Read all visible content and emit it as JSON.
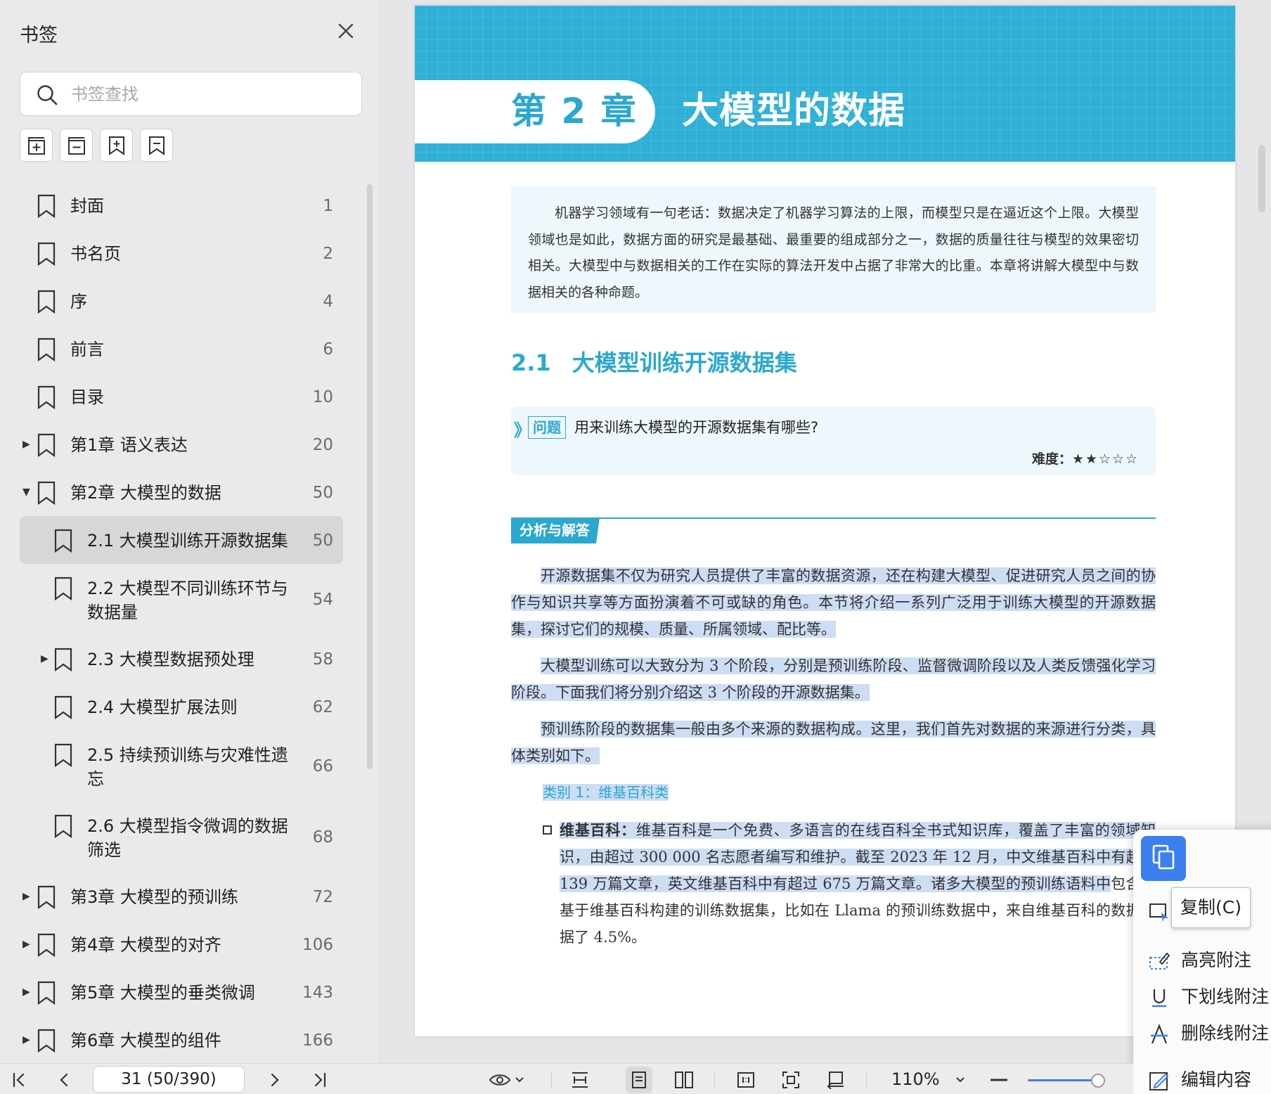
{
  "sidebar": {
    "title": "书签",
    "search_placeholder": "书签查找",
    "items": [
      {
        "label": "封面",
        "page": "1"
      },
      {
        "label": "书名页",
        "page": "2"
      },
      {
        "label": "序",
        "page": "4"
      },
      {
        "label": "前言",
        "page": "6"
      },
      {
        "label": "目录",
        "page": "10"
      },
      {
        "label": "第1章  语义表达",
        "page": "20"
      },
      {
        "label": "第2章  大模型的数据",
        "page": "50"
      },
      {
        "label": "2.1 大模型训练开源数据集",
        "page": "50"
      },
      {
        "label": "2.2 大模型不同训练环节与数据量",
        "page": "54"
      },
      {
        "label": "2.3 大模型数据预处理",
        "page": "58"
      },
      {
        "label": "2.4 大模型扩展法则",
        "page": "62"
      },
      {
        "label": "2.5 持续预训练与灾难性遗忘",
        "page": "66"
      },
      {
        "label": "2.6 大模型指令微调的数据筛选",
        "page": "68"
      },
      {
        "label": "第3章  大模型的预训练",
        "page": "72"
      },
      {
        "label": "第4章  大模型的对齐",
        "page": "106"
      },
      {
        "label": "第5章  大模型的垂类微调",
        "page": "143"
      },
      {
        "label": "第6章  大模型的组件",
        "page": "166"
      }
    ]
  },
  "doc": {
    "chapter_num": "第 2 章",
    "chapter_title": "大模型的数据",
    "intro": "机器学习领域有一句老话：数据决定了机器学习算法的上限，而模型只是在逼近这个上限。大模型领域也是如此，数据方面的研究是最基础、最重要的组成部分之一，数据的质量往往与模型的效果密切相关。大模型中与数据相关的工作在实际的算法开发中占据了非常大的比重。本章将讲解大模型中与数据相关的各种命题。",
    "section_num": "2.1",
    "section_title": "大模型训练开源数据集",
    "question_tag": "问题",
    "question_text": "用来训练大模型的开源数据集有哪些?",
    "difficulty_label": "难度：",
    "difficulty_stars": "★★☆☆☆",
    "difficulty_value": 2,
    "analysis_label": "分析与解答",
    "para1": "开源数据集不仅为研究人员提供了丰富的数据资源，还在构建大模型、促进研究人员之间的协作与知识共享等方面扮演着不可或缺的角色。本节将介绍一系列广泛用于训练大模型的开源数据集，探讨它们的规模、质量、所属领域、配比等。",
    "para2": "大模型训练可以大致分为 3 个阶段，分别是预训练阶段、监督微调阶段以及人类反馈强化学习阶段。下面我们将分别介绍这 3 个阶段的开源数据集。",
    "para3": "预训练阶段的数据集一般由多个来源的数据构成。这里，我们首先对数据的来源进行分类，具体类别如下。",
    "category": "类别 1：维基百科类",
    "item_title": "维基百科：",
    "item_text_hl": "维基百科是一个免费、多语言的在线百科全书式知识库，覆盖了丰富的领域知识，由超过 300 000 名志愿者编写和维护。截至 2023 年 12 月，中文维基百科中有超过 139 万篇文章，英文维基百科中有超过 675 万篇文章。诸多大模型的预训练语料中",
    "item_text_rest": "包含了基于维基百科构建的训练数据集，比如在 Llama 的预训练数据中，来自维基百科的数据占据了 4.5%。"
  },
  "context_menu": {
    "copy_tooltip": "复制(C)",
    "items": [
      "高亮附注",
      "下划线附注",
      "删除线附注",
      "编辑内容"
    ]
  },
  "toolbar": {
    "page_indicator": "31 (50/390)",
    "zoom": "110%",
    "zoom_slider_fraction": 0.9
  },
  "colors": {
    "accent": "#2aa8d0",
    "highlight": "#cdddf4",
    "ui_blue": "#3c7ff0"
  }
}
